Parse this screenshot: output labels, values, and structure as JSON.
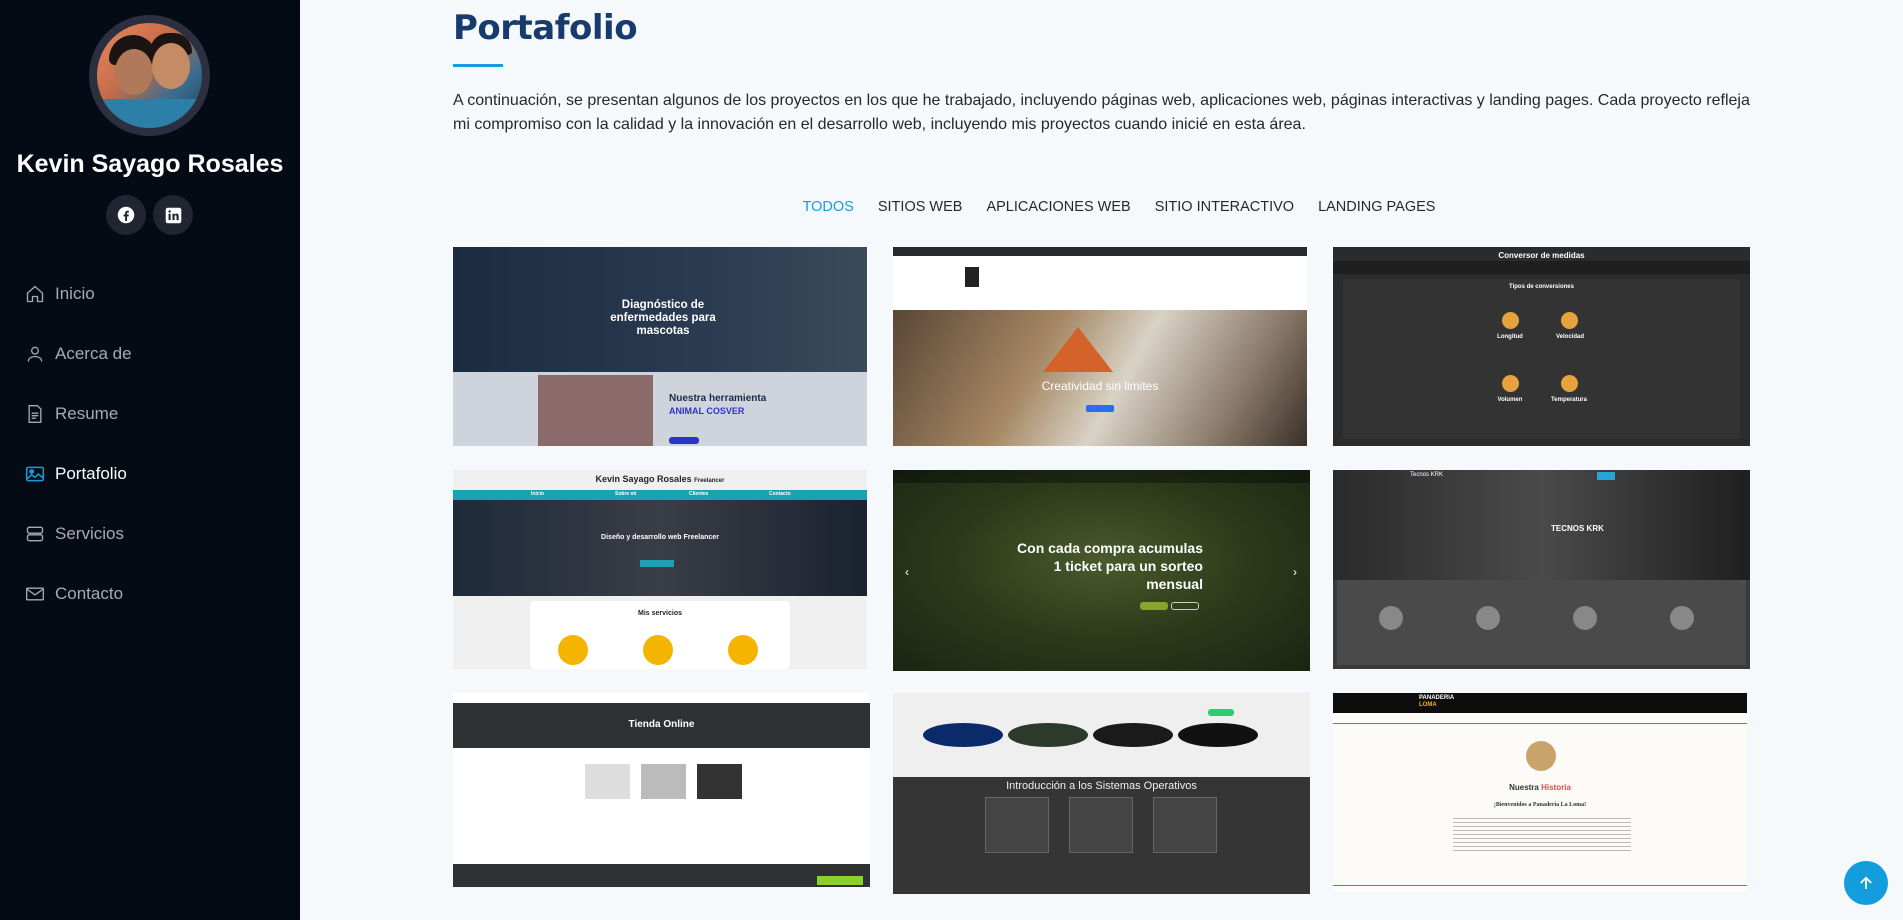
{
  "profile": {
    "name": "Kevin Sayago Rosales"
  },
  "social": [
    {
      "icon": "facebook-icon"
    },
    {
      "icon": "linkedin-icon"
    }
  ],
  "nav": {
    "items": [
      {
        "label": "Inicio",
        "icon": "home-icon",
        "active": false
      },
      {
        "label": "Acerca de",
        "icon": "user-icon",
        "active": false
      },
      {
        "label": "Resume",
        "icon": "file-icon",
        "active": false
      },
      {
        "label": "Portafolio",
        "icon": "image-icon",
        "active": true
      },
      {
        "label": "Servicios",
        "icon": "server-icon",
        "active": false
      },
      {
        "label": "Contacto",
        "icon": "envelope-icon",
        "active": false
      }
    ]
  },
  "portfolio": {
    "title": "Portafolio",
    "description": "A continuación, se presentan algunos de los proyectos en los que he trabajado, incluyendo páginas web, aplicaciones web, páginas interactivas y landing pages. Cada proyecto refleja mi compromiso con la calidad y la innovación en el desarrollo web, incluyendo mis proyectos cuando inicié en esta área.",
    "filters": [
      "TODOS",
      "SITIOS WEB",
      "APLICACIONES WEB",
      "SITIO INTERACTIVO",
      "LANDING PAGES"
    ],
    "active_filter": "TODOS"
  },
  "cards": {
    "vet": {
      "heading": "Diagnóstico de enfermedades para mascotas",
      "sub": "Nuestra herramienta",
      "brand": "ANIMAL COSVER"
    },
    "creative": {
      "heading": "Creatividad sin limites"
    },
    "converter": {
      "title": "Conversor de medidas",
      "subtitle": "Tipos de conversiones",
      "items": [
        "Longitud",
        "Velocidad",
        "Volumen",
        "Temperatura"
      ]
    },
    "freelancer": {
      "title": "Kevin Sayago Rosales",
      "badge": "Freelancer",
      "heading": "Diseño y desarrollo web Freelancer",
      "services": "Mis servicios",
      "menu": [
        "Inicio",
        "Sobre mi",
        "Clientes",
        "Contacto"
      ]
    },
    "ticket": {
      "heading": "Con cada compra acumulas 1 ticket para un sorteo mensual"
    },
    "tecnos": {
      "brand": "Tecnos KRK",
      "heading": "TECNOS KRK"
    },
    "shop": {
      "heading": "Tienda Online"
    },
    "os": {
      "heading": "Introducción a los Sistemas Operativos"
    },
    "bakery": {
      "brand": "PANADERIA",
      "brand2": "LOMA",
      "heading": "Nuestra",
      "heading_accent": "Historia",
      "welcome": "¡Bienvenidos a Panadería La Loma!"
    }
  },
  "colors": {
    "accent": "#149ddd",
    "sidebar": "#040b14"
  }
}
